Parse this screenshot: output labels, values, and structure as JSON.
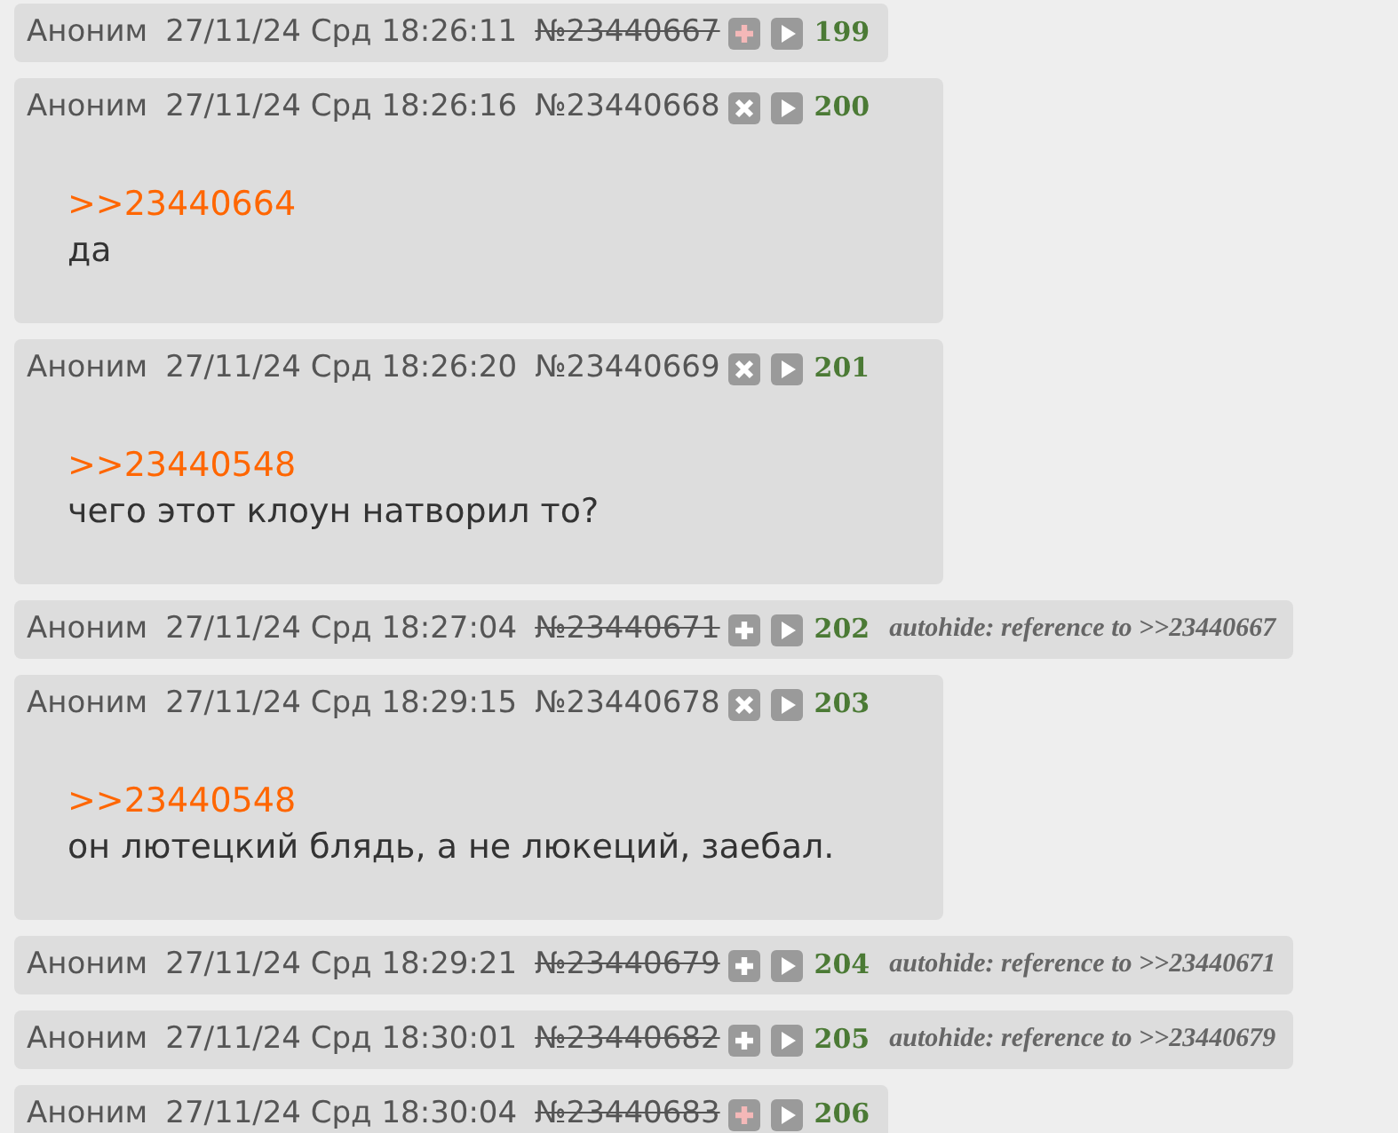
{
  "posts": [
    {
      "kind": "hidden",
      "author": "Аноним",
      "date": "27/11/24 Срд 18:26:11",
      "id": "№23440667",
      "index": "199"
    },
    {
      "kind": "visible",
      "author": "Аноним",
      "date": "27/11/24 Срд 18:26:16",
      "id": "№23440668",
      "index": "200",
      "reply": ">>23440664",
      "text": "да"
    },
    {
      "kind": "visible",
      "author": "Аноним",
      "date": "27/11/24 Срд 18:26:20",
      "id": "№23440669",
      "index": "201",
      "reply": ">>23440548",
      "text": "чего этот клоун натворил то?"
    },
    {
      "kind": "autohidden",
      "author": "Аноним",
      "date": "27/11/24 Срд 18:27:04",
      "id": "№23440671",
      "index": "202",
      "note": "autohide: reference to >>23440667"
    },
    {
      "kind": "visible",
      "author": "Аноним",
      "date": "27/11/24 Срд 18:29:15",
      "id": "№23440678",
      "index": "203",
      "reply": ">>23440548",
      "text": "он лютецкий блядь, а не люкеций, заебал."
    },
    {
      "kind": "autohidden",
      "author": "Аноним",
      "date": "27/11/24 Срд 18:29:21",
      "id": "№23440679",
      "index": "204",
      "note": "autohide: reference to >>23440671"
    },
    {
      "kind": "autohidden",
      "author": "Аноним",
      "date": "27/11/24 Срд 18:30:01",
      "id": "№23440682",
      "index": "205",
      "note": "autohide: reference to >>23440679"
    },
    {
      "kind": "hidden",
      "author": "Аноним",
      "date": "27/11/24 Срд 18:30:04",
      "id": "№23440683",
      "index": "206"
    }
  ]
}
